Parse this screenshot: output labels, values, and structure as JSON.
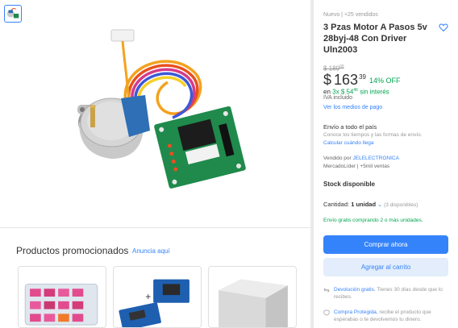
{
  "product": {
    "condition": "Nuevo  |  +25 vendidos",
    "title": "3 Pzas Motor A Pasos 5v 28byj-48 Con Driver Uln2003",
    "old_price": "$ 189",
    "old_price_cents": "00",
    "price_currency": "$",
    "price": "163",
    "price_cents": "39",
    "discount": "14% OFF",
    "installments_prefix": "en",
    "installments_highlight": "3x $ 54",
    "installments_cents": "46",
    "installments_suffix": "sin interés",
    "iva": "IVA incluido",
    "payment_link": "Ver los medios de pago"
  },
  "shipping": {
    "title": "Envío a todo el país",
    "subtitle": "Conoce los tiempos y las formas de envío.",
    "link": "Calcular cuándo llega"
  },
  "seller": {
    "prefix": "Vendido por",
    "name": "JELELECTRONICA",
    "meta": "MercadoLíder  |  +5mil ventas"
  },
  "stock": {
    "label": "Stock disponible",
    "qty_label": "Cantidad:",
    "qty_value": "1 unidad",
    "qty_available": "(3 disponibles)",
    "free_shipping": "Envío gratis comprando 2 o más unidades."
  },
  "buttons": {
    "buy": "Comprar ahora",
    "cart": "Agregar al carrito"
  },
  "benefits": {
    "returns_link": "Devolución gratis.",
    "returns_text": "Tienes 30 días desde que lo recibes.",
    "protect_link": "Compra Protegida,",
    "protect_text": "recibe el producto que esperabas o te devolvemos tu dinero."
  },
  "promo": {
    "title": "Productos promocionados",
    "link": "Anuncia aquí"
  },
  "colors": {
    "accent": "#3483fa",
    "green": "#00a650",
    "pcb_green": "#1f8a4c",
    "motor_blue": "#2e6fb5"
  }
}
